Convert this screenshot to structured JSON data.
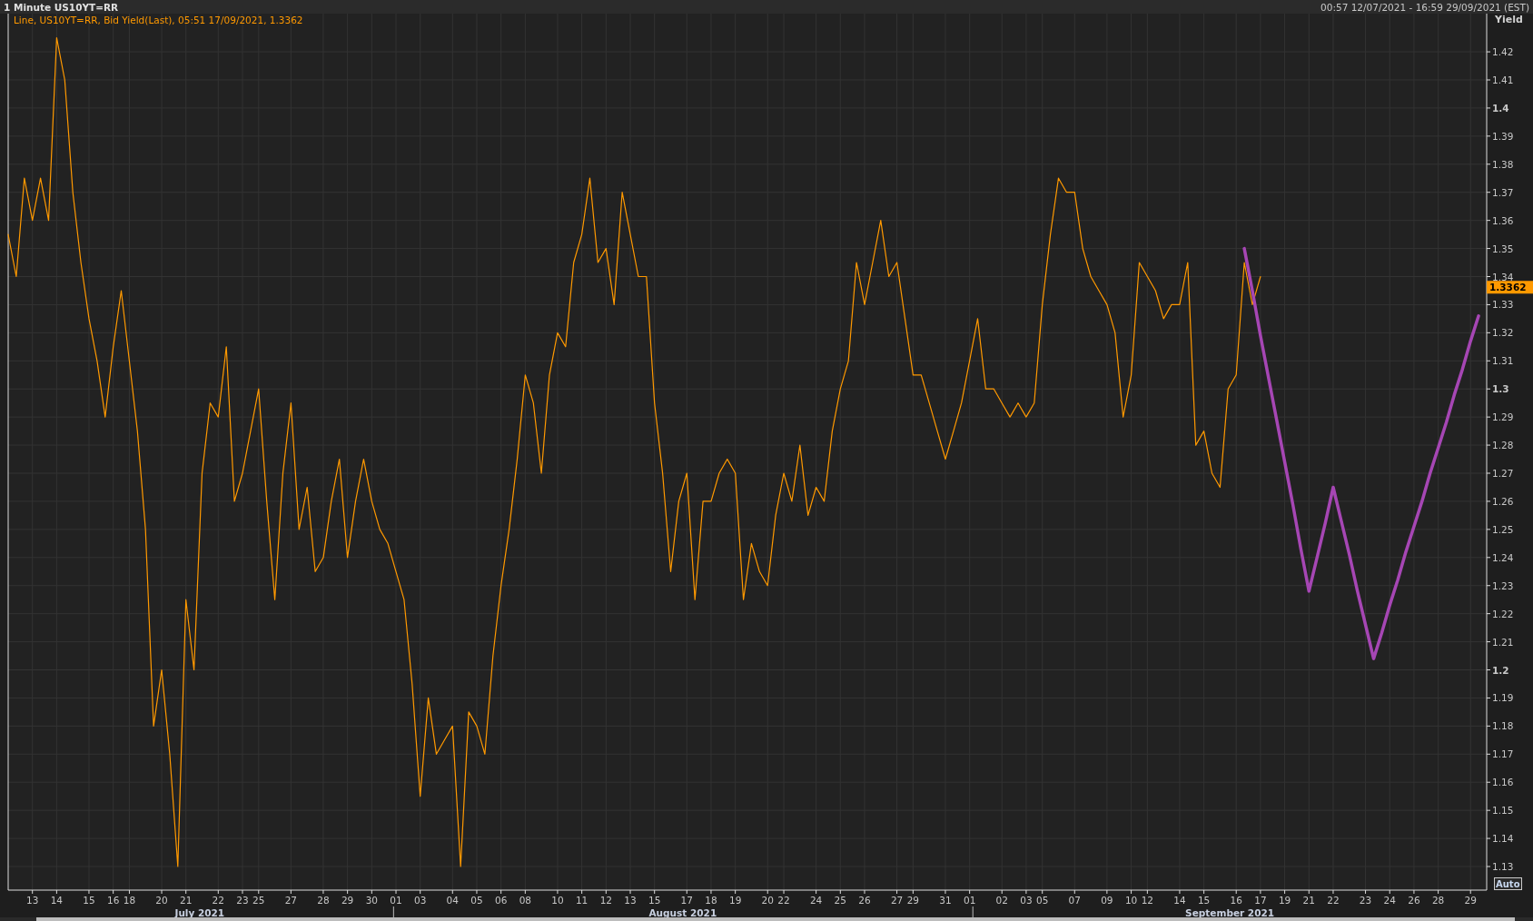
{
  "title_bar": {
    "title": "1 Minute US10YT=RR",
    "range": "00:57 12/07/2021 - 16:59 29/09/2021 (EST)"
  },
  "chart": {
    "legend": "Line, US10YT=RR, Bid Yield(Last), 05:51 17/09/2021, 1.3362",
    "last_value": "1.3362",
    "auto_button": "Auto",
    "chart_data": {
      "type": "line",
      "ylabel": "Yield",
      "grid": true,
      "ylim": [
        1.1216,
        1.4336
      ],
      "categories": [
        null,
        null,
        null,
        "13",
        null,
        null,
        "14",
        null,
        null,
        null,
        "15",
        null,
        null,
        "16",
        null,
        "18",
        null,
        null,
        null,
        "20",
        null,
        null,
        "21",
        null,
        null,
        null,
        "22",
        null,
        null,
        "23",
        null,
        "25",
        null,
        null,
        null,
        "27",
        null,
        null,
        null,
        "28",
        null,
        null,
        "29",
        null,
        null,
        "30",
        null,
        null,
        "01",
        null,
        null,
        "03",
        null,
        null,
        null,
        "04",
        null,
        null,
        "05",
        null,
        null,
        "06",
        null,
        null,
        "08",
        null,
        null,
        null,
        "10",
        null,
        null,
        "11",
        null,
        null,
        "12",
        null,
        null,
        "13",
        null,
        null,
        "15",
        null,
        null,
        null,
        "17",
        null,
        null,
        "18",
        null,
        null,
        "19",
        null,
        null,
        null,
        "20",
        null,
        "22",
        null,
        null,
        null,
        "24",
        null,
        null,
        "25",
        null,
        null,
        "26",
        null,
        null,
        null,
        "27",
        null,
        "29",
        null,
        null,
        null,
        "31",
        null,
        null,
        "01",
        null,
        null,
        null,
        "02",
        null,
        null,
        "03",
        null,
        "05",
        null,
        null,
        null,
        "07",
        null,
        null,
        null,
        "09",
        null,
        null,
        "10",
        null,
        "12",
        null,
        null,
        null,
        "14",
        null,
        null,
        "15",
        null,
        null,
        null,
        "16",
        null,
        null,
        "17",
        null,
        null,
        "19",
        null,
        null,
        "21",
        null,
        null,
        "22",
        null,
        null,
        null,
        "23",
        null,
        null,
        "24",
        null,
        null,
        "26",
        null,
        null,
        "28",
        null,
        null,
        null,
        "29",
        null,
        null
      ],
      "series": [
        {
          "color": "#ff9900",
          "values": [
            1.355,
            1.34,
            1.375,
            1.36,
            1.375,
            1.36,
            1.425,
            1.41,
            1.37,
            1.345,
            1.325,
            1.31,
            1.29,
            1.315,
            1.335,
            1.31,
            1.285,
            1.25,
            1.18,
            1.2,
            1.17,
            1.13,
            1.225,
            1.2,
            1.27,
            1.295,
            1.29,
            1.315,
            1.26,
            1.27,
            1.285,
            1.3,
            1.26,
            1.225,
            1.27,
            1.295,
            1.25,
            1.265,
            1.235,
            1.24,
            1.26,
            1.275,
            1.24,
            1.26,
            1.275,
            1.26,
            1.25,
            1.245,
            1.235,
            1.225,
            1.195,
            1.155,
            1.19,
            1.17,
            1.175,
            1.18,
            1.13,
            1.185,
            1.18,
            1.17,
            1.205,
            1.23,
            1.25,
            1.275,
            1.305,
            1.295,
            1.27,
            1.305,
            1.32,
            1.315,
            1.345,
            1.355,
            1.375,
            1.345,
            1.35,
            1.33,
            1.37,
            1.355,
            1.34,
            1.34,
            1.295,
            1.27,
            1.235,
            1.26,
            1.27,
            1.225,
            1.26,
            1.26,
            1.27,
            1.275,
            1.27,
            1.225,
            1.245,
            1.235,
            1.23,
            1.255,
            1.27,
            1.26,
            1.28,
            1.255,
            1.265,
            1.26,
            1.285,
            1.3,
            1.31,
            1.345,
            1.33,
            1.345,
            1.36,
            1.34,
            1.345,
            1.325,
            1.305,
            1.305,
            1.295,
            1.285,
            1.275,
            1.285,
            1.295,
            1.31,
            1.325,
            1.3,
            1.3,
            1.295,
            1.29,
            1.295,
            1.29,
            1.295,
            1.33,
            1.355,
            1.375,
            1.37,
            1.37,
            1.35,
            1.34,
            1.335,
            1.33,
            1.32,
            1.29,
            1.305,
            1.345,
            1.34,
            1.335,
            1.325,
            1.33,
            1.33,
            1.345,
            1.28,
            1.285,
            1.27,
            1.265,
            1.3,
            1.305,
            1.345,
            1.33,
            1.34,
            null,
            null,
            null,
            null,
            null,
            null,
            null,
            null,
            null,
            null,
            null,
            null,
            null,
            null,
            null,
            null,
            null,
            null,
            null,
            null,
            null,
            null,
            null,
            null,
            null,
            null,
            null,
            null
          ]
        },
        {
          "color": "#a646b4",
          "values": [
            null,
            null,
            null,
            null,
            null,
            null,
            null,
            null,
            null,
            null,
            null,
            null,
            null,
            null,
            null,
            null,
            null,
            null,
            null,
            null,
            null,
            null,
            null,
            null,
            null,
            null,
            null,
            null,
            null,
            null,
            null,
            null,
            null,
            null,
            null,
            null,
            null,
            null,
            null,
            null,
            null,
            null,
            null,
            null,
            null,
            null,
            null,
            null,
            null,
            null,
            null,
            null,
            null,
            null,
            null,
            null,
            null,
            null,
            null,
            null,
            null,
            null,
            null,
            null,
            null,
            null,
            null,
            null,
            null,
            null,
            null,
            null,
            null,
            null,
            null,
            null,
            null,
            null,
            null,
            null,
            null,
            null,
            null,
            null,
            null,
            null,
            null,
            null,
            null,
            null,
            null,
            null,
            null,
            null,
            null,
            null,
            null,
            null,
            null,
            null,
            null,
            null,
            null,
            null,
            null,
            null,
            null,
            null,
            null,
            null,
            null,
            null,
            null,
            null,
            null,
            null,
            null,
            null,
            null,
            null,
            null,
            null,
            null,
            null,
            null,
            null,
            null,
            null,
            null,
            null,
            null,
            null,
            null,
            null,
            null,
            null,
            null,
            null,
            null,
            null,
            null,
            null,
            null,
            null,
            null,
            null,
            null,
            null,
            null,
            null,
            null,
            null,
            null,
            1.35,
            1.335,
            1.319,
            1.304,
            1.289,
            1.274,
            1.259,
            1.243,
            1.228,
            1.24,
            1.252,
            1.265,
            1.253,
            1.241,
            1.228,
            1.216,
            1.204,
            1.213,
            1.223,
            1.232,
            1.242,
            1.251,
            1.26,
            1.27,
            1.279,
            1.288,
            1.298,
            1.307,
            1.317,
            1.326,
            null
          ]
        }
      ],
      "yticks": [
        1.13,
        1.14,
        1.15,
        1.16,
        1.17,
        1.18,
        1.19,
        {
          "value": 1.2,
          "label": "1.2"
        },
        1.21,
        1.22,
        1.23,
        1.24,
        1.25,
        1.26,
        1.27,
        1.28,
        1.29,
        {
          "value": 1.3,
          "label": "1.3"
        },
        1.31,
        1.32,
        1.33,
        1.34,
        1.35,
        1.36,
        1.37,
        1.38,
        1.39,
        {
          "value": 1.4,
          "label": "1.4"
        },
        1.41,
        1.42
      ],
      "annotations": [
        "July 2021",
        "August 2021",
        "September 2021"
      ]
    }
  }
}
